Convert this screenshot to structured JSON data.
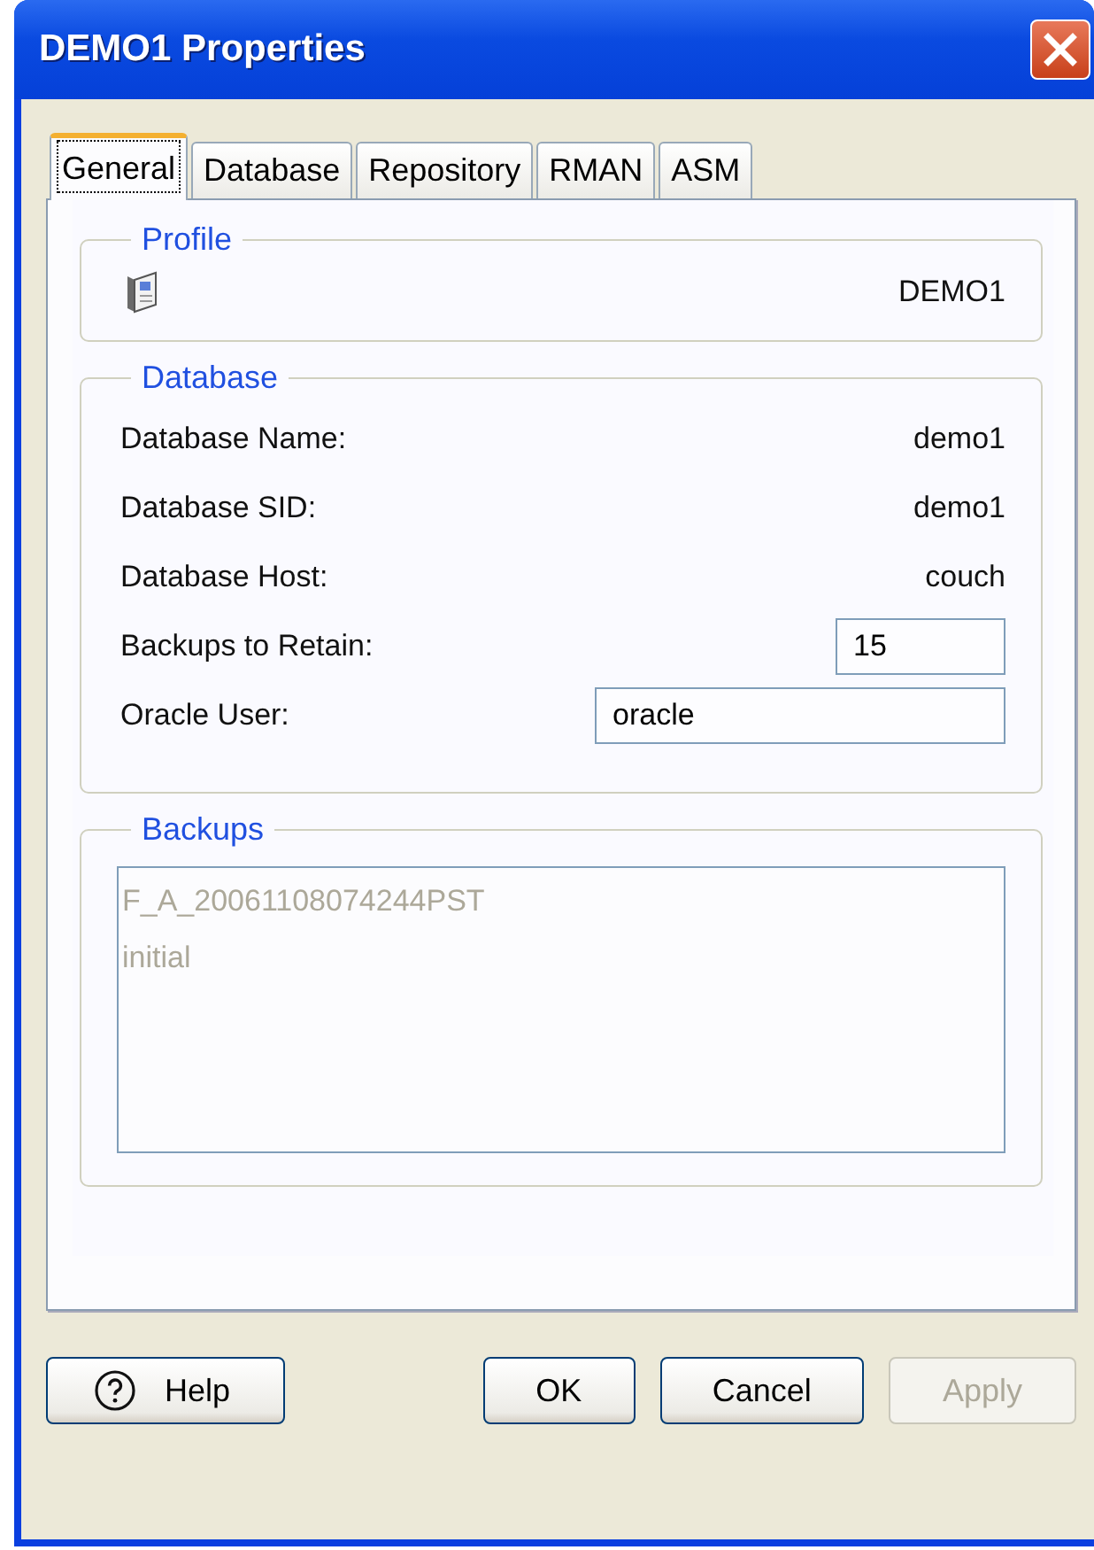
{
  "window": {
    "title": "DEMO1 Properties"
  },
  "tabs": [
    {
      "label": "General",
      "selected": true
    },
    {
      "label": "Database",
      "selected": false
    },
    {
      "label": "Repository",
      "selected": false
    },
    {
      "label": "RMAN",
      "selected": false
    },
    {
      "label": "ASM",
      "selected": false
    }
  ],
  "profile": {
    "title": "Profile",
    "name": "DEMO1"
  },
  "database": {
    "title": "Database",
    "rows": [
      {
        "kind": "value",
        "label": "Database Name:",
        "value": "demo1"
      },
      {
        "kind": "value",
        "label": "Database SID:",
        "value": "demo1"
      },
      {
        "kind": "value",
        "label": "Database Host:",
        "value": "couch"
      },
      {
        "kind": "count",
        "label": "Backups to Retain:",
        "value": "15"
      },
      {
        "kind": "text",
        "label": "Oracle User:",
        "value": "oracle"
      }
    ]
  },
  "backups": {
    "title": "Backups",
    "disabled": true,
    "items": [
      "F_A_20061108074244PST",
      "initial"
    ]
  },
  "buttons": [
    {
      "kind": "help",
      "label": "Help",
      "disabled": false
    },
    {
      "kind": "plain",
      "label": "OK",
      "disabled": false
    },
    {
      "kind": "plain",
      "label": "Cancel",
      "disabled": false
    },
    {
      "kind": "plain",
      "label": "Apply",
      "disabled": true
    }
  ]
}
